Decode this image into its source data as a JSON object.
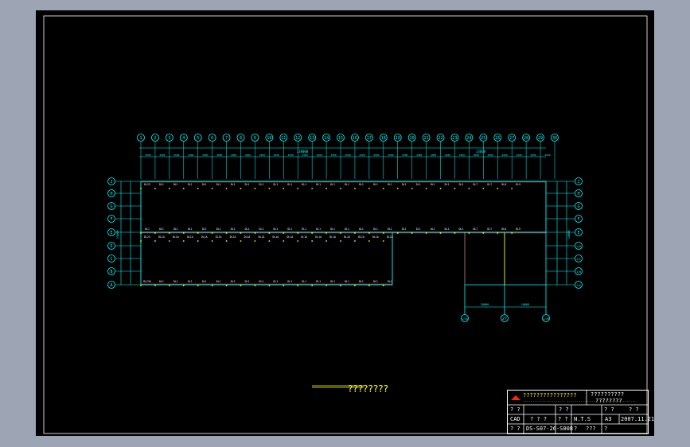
{
  "drawing": {
    "title": "????????",
    "top_axes": [
      "1",
      "2",
      "3",
      "4",
      "5",
      "6",
      "7",
      "8",
      "9",
      "10",
      "11",
      "12",
      "13",
      "14",
      "15",
      "16",
      "17",
      "18",
      "19",
      "20",
      "21",
      "22",
      "23",
      "24",
      "25",
      "26",
      "27",
      "28",
      "29",
      "30"
    ],
    "left_axes": [
      "J",
      "H",
      "G",
      "F",
      "E",
      "D",
      "C",
      "B",
      "A"
    ],
    "right_axes": [
      "J",
      "H",
      "G",
      "F",
      "E",
      "1/D",
      "1/C",
      "1/B",
      "1/A"
    ],
    "bottom_axes": [
      "1/26",
      "27",
      "1/28"
    ],
    "row_labels": {
      "row_j": [
        "DL23",
        "DL1",
        "DL1",
        "DL1",
        "DL1",
        "DL1",
        "DL1",
        "DL1",
        "DL1",
        "DL1",
        "DL1",
        "DL1",
        "DL1",
        "DL1",
        "DL1",
        "DL1",
        "DL1",
        "DL1",
        "DL1",
        "DL1",
        "DL1",
        "DL1",
        "DL1",
        "DL7",
        "DL7",
        "DL8",
        "DL9"
      ],
      "row_e_upper": [
        "DL1",
        "DL1",
        "DL1",
        "DL1",
        "DL1",
        "DL1",
        "DL1",
        "DL1",
        "DL1",
        "DL1",
        "DL1",
        "DL1",
        "DL1",
        "DL1",
        "DL1",
        "DL1",
        "DL1",
        "DL1",
        "DL1",
        "DL1",
        "DL1",
        "DL1",
        "DL1",
        "DL7",
        "DL7",
        "DL8",
        "DL9"
      ],
      "row_e_lower": [
        "DL23",
        "DL1A",
        "DL1A",
        "DL1A",
        "DL1A",
        "DL1A",
        "DL1A",
        "DL1A",
        "DL1A",
        "DL1A",
        "DL1A",
        "DL1A",
        "DL1A",
        "DL1A",
        "DL1A",
        "DL1A",
        "DL1A",
        "DL1A"
      ],
      "row_a": [
        "DL23A",
        "DL1",
        "DL1",
        "DL1",
        "DL1",
        "DL1",
        "DL1",
        "DL1",
        "DL1",
        "DL1",
        "DL1",
        "DL1",
        "DL1",
        "DL1",
        "DL1",
        "DL1",
        "DL1",
        "DL1"
      ]
    },
    "dims": {
      "overall": "138000",
      "overall_right": "13600",
      "segment": "4500",
      "bottom_left": "20000",
      "bottom_right": "10000",
      "left_overall": "21000",
      "right_overall": "14000"
    }
  },
  "title_block": {
    "company": "????????????????",
    "company_sub": "...................... ................ ...................",
    "project": "??????????",
    "project_sub": "????????",
    "r2c1": "? ?",
    "r2c2": "? ?",
    "r2c3": "? ?",
    "r2c4": "? ?",
    "r3c1": "CAD",
    "r3c2": "? ? ?",
    "r3c3": "? ?",
    "r3c4": "N.T.S",
    "r3c5": "A3",
    "r3c6": "2007.11.21",
    "r4c1": "? ?",
    "r4c2": "DS-S07-26-S008",
    "r4c3": "?",
    "r4c4": "???",
    "r4c5": "?"
  },
  "colors": {
    "background": "#9da5b5",
    "sheet": "#000000",
    "axis": "#00ffff",
    "beam": "#ff3030",
    "text": "#ffffff",
    "title": "#ffff00"
  }
}
